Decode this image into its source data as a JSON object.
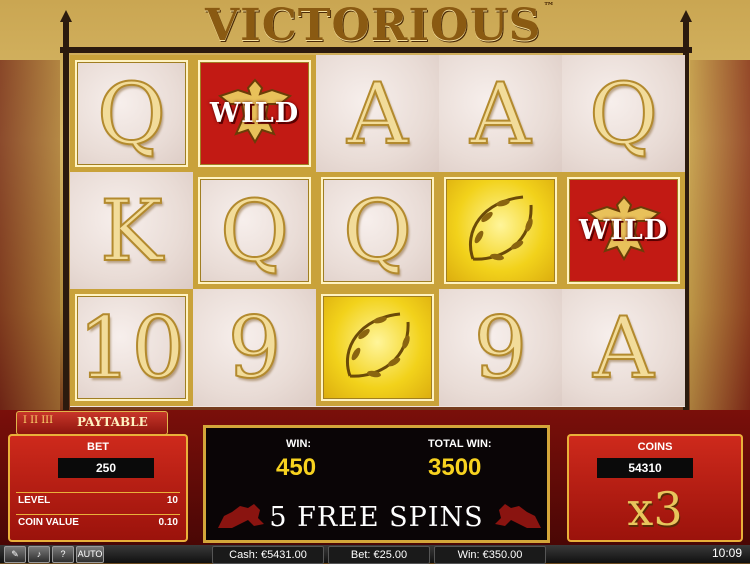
{
  "game": {
    "title": "VICTORIOUS",
    "trademark": "™"
  },
  "colors": {
    "wild_red": "#c21a14",
    "gold_frame": "#c9a23a",
    "win_yellow": "#f7d21f"
  },
  "reels": [
    [
      {
        "symbol": "Q",
        "type": "letter",
        "framed": true
      },
      {
        "symbol": "K",
        "type": "letter",
        "framed": false
      },
      {
        "symbol": "10",
        "type": "letter",
        "framed": true
      }
    ],
    [
      {
        "symbol": "WILD",
        "type": "wild",
        "icon": "eagle-icon",
        "framed": true
      },
      {
        "symbol": "Q",
        "type": "letter",
        "framed": true
      },
      {
        "symbol": "9",
        "type": "letter",
        "framed": false
      }
    ],
    [
      {
        "symbol": "A",
        "type": "letter",
        "framed": false
      },
      {
        "symbol": "Q",
        "type": "letter",
        "framed": true
      },
      {
        "symbol": "laurel",
        "type": "gold",
        "icon": "laurel-wreath-icon",
        "framed": true
      }
    ],
    [
      {
        "symbol": "A",
        "type": "letter",
        "framed": false
      },
      {
        "symbol": "laurel",
        "type": "gold",
        "icon": "laurel-wreath-icon",
        "framed": true
      },
      {
        "symbol": "9",
        "type": "letter",
        "framed": false
      }
    ],
    [
      {
        "symbol": "Q",
        "type": "letter",
        "framed": false
      },
      {
        "symbol": "WILD",
        "type": "wild",
        "icon": "eagle-icon",
        "framed": true
      },
      {
        "symbol": "A",
        "type": "letter",
        "framed": false
      }
    ]
  ],
  "paytable": {
    "label": "PAYTABLE",
    "icon": "roman-numerals-icon",
    "icon_text": "I II III"
  },
  "bet_panel": {
    "bet_label": "BET",
    "bet_value": "250",
    "level_label": "LEVEL",
    "level_value": "10",
    "coin_value_label": "COIN VALUE",
    "coin_value": "0.10"
  },
  "win_panel": {
    "win_label": "WIN:",
    "win_value": "450",
    "total_win_label": "TOTAL WIN:",
    "total_win_value": "3500",
    "free_spins_text": "5 FREE SPINS"
  },
  "coins_panel": {
    "coins_label": "COINS",
    "coins_value": "54310",
    "multiplier": "x3"
  },
  "bottom_bar": {
    "buttons": [
      {
        "icon": "settings-wrench-icon",
        "label": ""
      },
      {
        "icon": "sound-icon",
        "label": ""
      },
      {
        "icon": "help-icon",
        "label": "?"
      },
      {
        "icon": "auto-icon",
        "label": "AUTO"
      }
    ],
    "cash": "Cash: €5431.00",
    "bet": "Bet: €25.00",
    "win": "Win: €350.00",
    "clock": "10:09"
  }
}
